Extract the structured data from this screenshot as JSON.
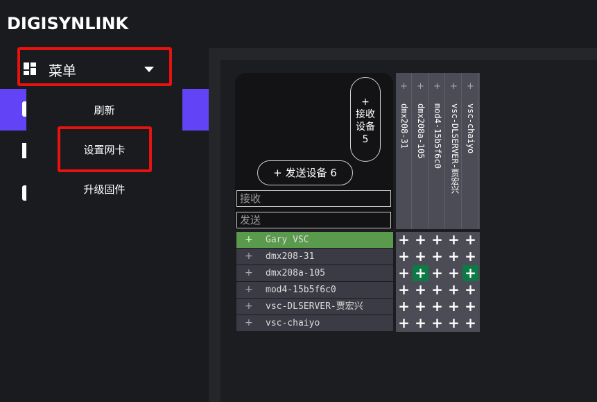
{
  "brand": "DIGISYNLINK",
  "menu": {
    "label": "菜单",
    "items": [
      "刷新",
      "设置网卡",
      "升级固件"
    ]
  },
  "matrix": {
    "receive_button": {
      "plus": "+",
      "line1": "接收",
      "line2": "设备",
      "count": "5"
    },
    "send_button": "+ 发送设备 6",
    "filter_receive_placeholder": "接收",
    "filter_send_placeholder": "发送",
    "receivers": [
      "dmx208-31",
      "dmx208a-105",
      "mod4-15b5f6c0",
      "vsc-DLSERVER-贾宏兴",
      "vsc-chaiyo"
    ],
    "senders": [
      "Gary VSC",
      "dmx208-31",
      "dmx208a-105",
      "mod4-15b5f6c0",
      "vsc-DLSERVER-贾宏兴",
      "vsc-chaiyo"
    ],
    "selected_sender": 0,
    "routes_on": [
      [
        2,
        1
      ],
      [
        2,
        4
      ]
    ]
  },
  "colors": {
    "accent": "#6243f5",
    "highlight": "#e8130f",
    "route_on": "#0b7a45",
    "selected_row": "#5a9a4c"
  }
}
